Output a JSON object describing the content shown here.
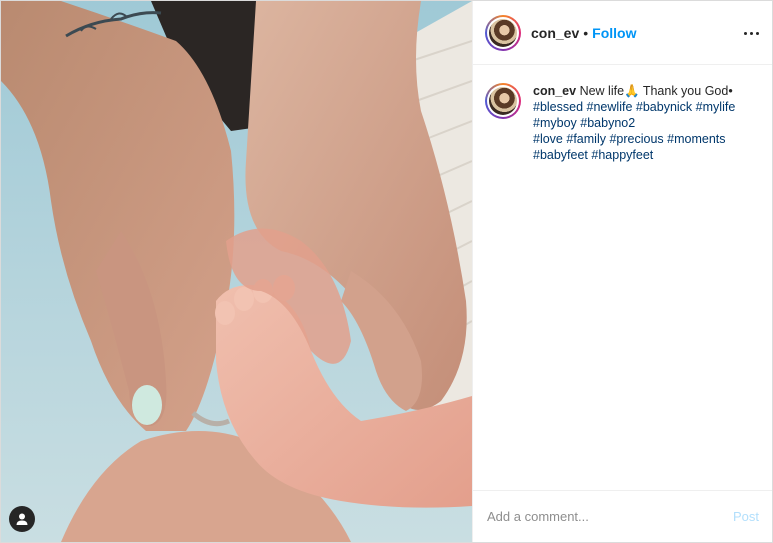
{
  "post": {
    "username": "con_ev",
    "separator": "•",
    "follow_label": "Follow",
    "more_options_icon": "more-horizontal-icon",
    "photo_alt": "Adult hands cupping a baby's foot"
  },
  "caption": {
    "username": "con_ev",
    "text": "New life🙏 Thank you God•",
    "hashtag_lines": [
      [
        "#blessed",
        "#newlife",
        "#babynick",
        "#mylife"
      ],
      [
        "#myboy",
        "#babyno2"
      ],
      [
        "#love",
        "#family",
        "#precious",
        "#moments"
      ],
      [
        "#babyfeet",
        "#happyfeet"
      ]
    ]
  },
  "comment": {
    "placeholder": "Add a comment...",
    "post_label": "Post"
  },
  "colors": {
    "link_blue": "#0095f6",
    "hashtag": "#00376b",
    "post_disabled": "#b2dffc"
  },
  "icons": {
    "user_tag": "user-tag-icon",
    "more": "more-horizontal-icon"
  }
}
